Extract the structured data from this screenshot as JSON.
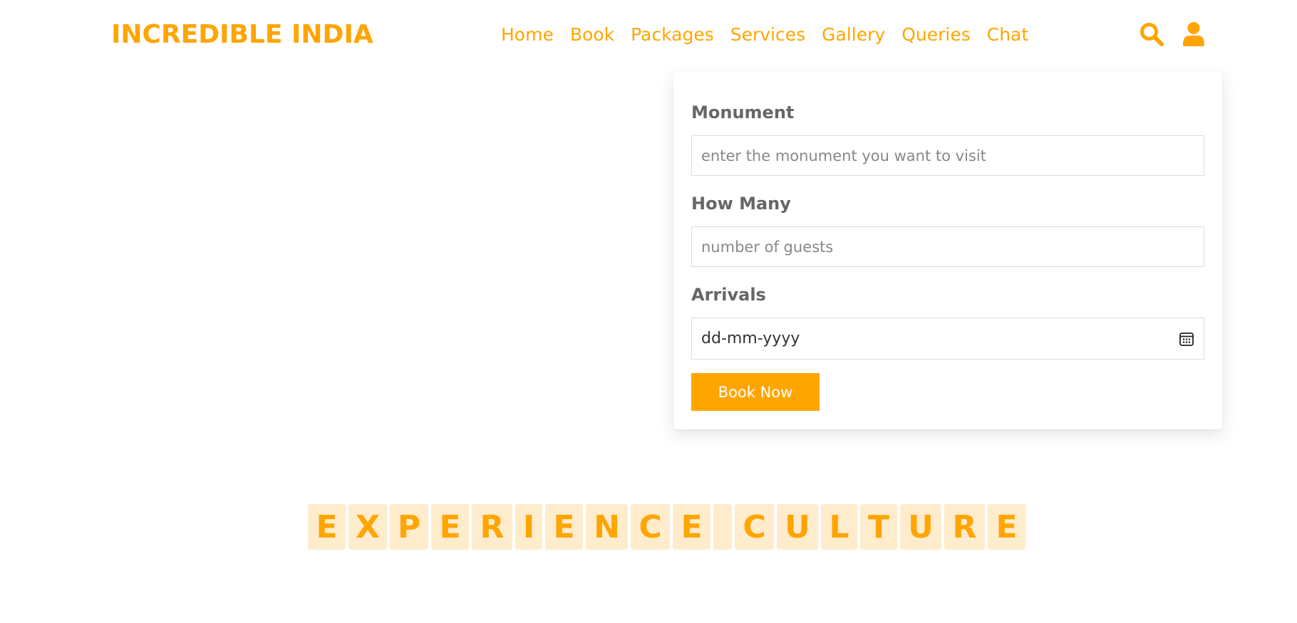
{
  "header": {
    "logo": "INCREDIBLE INDIA",
    "nav": [
      "Home",
      "Book",
      "Packages",
      "Services",
      "Gallery",
      "Queries",
      "Chat"
    ],
    "icons": [
      "search-icon",
      "user-icon"
    ]
  },
  "form": {
    "monument_label": "Monument",
    "monument_placeholder": "enter the monument you want to visit",
    "guests_label": "How Many",
    "guests_placeholder": "number of guests",
    "arrivals_label": "Arrivals",
    "arrivals_value": "dd-mm-yyyy",
    "book_button": "Book Now"
  },
  "heading": {
    "letters": [
      "E",
      "X",
      "P",
      "E",
      "R",
      "I",
      "E",
      "N",
      "C",
      "E",
      " ",
      "C",
      "U",
      "L",
      "T",
      "U",
      "R",
      "E"
    ]
  },
  "colors": {
    "accent": "#ffa500",
    "tile_bg": "#ffeccc",
    "label": "#666666"
  }
}
